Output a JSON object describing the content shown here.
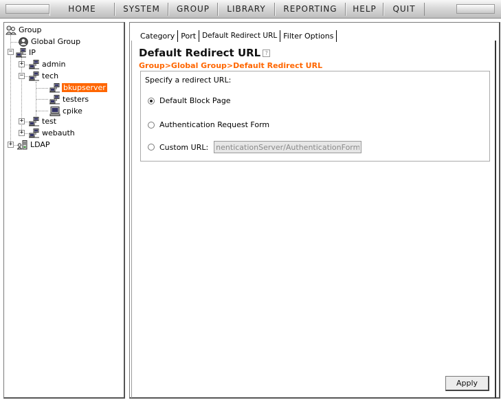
{
  "menu": {
    "items": [
      "HOME",
      "SYSTEM",
      "GROUP",
      "LIBRARY",
      "REPORTING",
      "HELP",
      "QUIT"
    ]
  },
  "tree": {
    "group": "Group",
    "global_group": "Global Group",
    "ip": "IP",
    "admin": "admin",
    "tech": "tech",
    "bkupserver": "bkupserver",
    "testers": "testers",
    "cpike": "cpike",
    "test": "test",
    "webauth": "webauth",
    "ldap": "LDAP"
  },
  "tabs": {
    "category": "Category",
    "port": "Port",
    "default_redirect": "Default Redirect URL",
    "filter_options": "Filter Options"
  },
  "page": {
    "title": "Default Redirect URL",
    "breadcrumb": "Group>Global Group>Default Redirect URL"
  },
  "redirect": {
    "legend": "Specify a redirect URL:",
    "option_block_page": "Default Block Page",
    "option_auth_form": "Authentication Request Form",
    "option_custom_url": "Custom URL:",
    "custom_url_value": "nenticationServer/AuthenticationForm.jsp",
    "selected": "Default Block Page"
  },
  "actions": {
    "apply": "Apply"
  },
  "colors": {
    "accent": "#ff6600",
    "selected_bg": "#ff6600"
  }
}
